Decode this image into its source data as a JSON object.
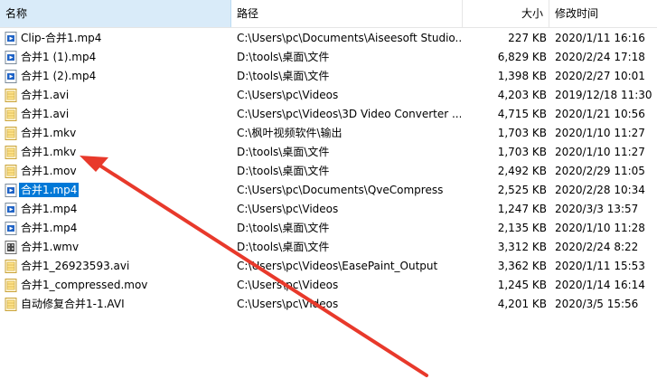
{
  "columns": {
    "name": "名称",
    "path": "路径",
    "size": "大小",
    "date": "修改时间"
  },
  "colors": {
    "selection": "#0078d7",
    "header_active": "#d9ebf9",
    "arrow": "#e8392b"
  },
  "rows": [
    {
      "icon": "video-file-icon",
      "name": "Clip-合并1.mp4",
      "path": "C:\\Users\\pc\\Documents\\Aiseesoft Studio...",
      "size": "227 KB",
      "date": "2020/1/11 16:16"
    },
    {
      "icon": "video-file-icon",
      "name": "合并1 (1).mp4",
      "path": "D:\\tools\\桌面\\文件",
      "size": "6,829 KB",
      "date": "2020/2/24 17:18"
    },
    {
      "icon": "video-file-icon",
      "name": "合并1 (2).mp4",
      "path": "D:\\tools\\桌面\\文件",
      "size": "1,398 KB",
      "date": "2020/2/27 10:01"
    },
    {
      "icon": "media-file-icon",
      "name": "合并1.avi",
      "path": "C:\\Users\\pc\\Videos",
      "size": "4,203 KB",
      "date": "2019/12/18 11:30"
    },
    {
      "icon": "media-file-icon",
      "name": "合并1.avi",
      "path": "C:\\Users\\pc\\Videos\\3D Video Converter ...",
      "size": "4,715 KB",
      "date": "2020/1/21 10:56"
    },
    {
      "icon": "media-file-icon",
      "name": "合并1.mkv",
      "path": "C:\\枫叶视频软件\\输出",
      "size": "1,703 KB",
      "date": "2020/1/10 11:27"
    },
    {
      "icon": "media-file-icon",
      "name": "合并1.mkv",
      "path": "D:\\tools\\桌面\\文件",
      "size": "1,703 KB",
      "date": "2020/1/10 11:27"
    },
    {
      "icon": "media-file-icon",
      "name": "合并1.mov",
      "path": "D:\\tools\\桌面\\文件",
      "size": "2,492 KB",
      "date": "2020/2/29 11:05"
    },
    {
      "icon": "video-file-icon",
      "name": "合并1.mp4",
      "path": "C:\\Users\\pc\\Documents\\QveCompress",
      "size": "2,525 KB",
      "date": "2020/2/28 10:34",
      "selected": true
    },
    {
      "icon": "video-file-icon",
      "name": "合并1.mp4",
      "path": "C:\\Users\\pc\\Videos",
      "size": "1,247 KB",
      "date": "2020/3/3 13:57"
    },
    {
      "icon": "video-file-icon",
      "name": "合并1.mp4",
      "path": "D:\\tools\\桌面\\文件",
      "size": "2,135 KB",
      "date": "2020/1/10 11:28"
    },
    {
      "icon": "wmv-file-icon",
      "name": "合并1.wmv",
      "path": "D:\\tools\\桌面\\文件",
      "size": "3,312 KB",
      "date": "2020/2/24 8:22"
    },
    {
      "icon": "media-file-icon",
      "name": "合并1_26923593.avi",
      "path": "C:\\Users\\pc\\Videos\\EasePaint_Output",
      "size": "3,362 KB",
      "date": "2020/1/11 15:53"
    },
    {
      "icon": "media-file-icon",
      "name": "合并1_compressed.mov",
      "path": "C:\\Users\\pc\\Videos",
      "size": "1,245 KB",
      "date": "2020/1/14 16:14"
    },
    {
      "icon": "media-file-icon",
      "name": "自动修复合并1-1.AVI",
      "path": "C:\\Users\\pc\\Videos",
      "size": "4,201 KB",
      "date": "2020/3/5 15:56"
    }
  ]
}
